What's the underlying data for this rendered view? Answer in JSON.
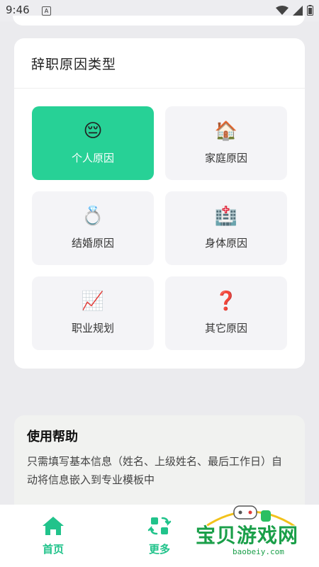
{
  "status_bar": {
    "time": "9:46",
    "badge": "A"
  },
  "section": {
    "title": "辞职原因类型"
  },
  "reasons": [
    {
      "label": "个人原因",
      "icon": "😔",
      "selected": true
    },
    {
      "label": "家庭原因",
      "icon": "🏠",
      "selected": false
    },
    {
      "label": "结婚原因",
      "icon": "💍",
      "selected": false
    },
    {
      "label": "身体原因",
      "icon": "🏥",
      "selected": false
    },
    {
      "label": "职业规划",
      "icon": "📈",
      "selected": false
    },
    {
      "label": "其它原因",
      "icon": "❓",
      "selected": false
    }
  ],
  "help": {
    "title": "使用帮助",
    "text": "只需填写基本信息（姓名、上级姓名、最后工作日）自动将信息嵌入到专业模板中"
  },
  "nav": {
    "home_label": "首页",
    "more_label": "更多"
  },
  "watermark": {
    "text": "宝贝游戏网",
    "url": "baobeiy.com"
  },
  "colors": {
    "accent": "#27d196",
    "nav_active": "#21c38b"
  }
}
